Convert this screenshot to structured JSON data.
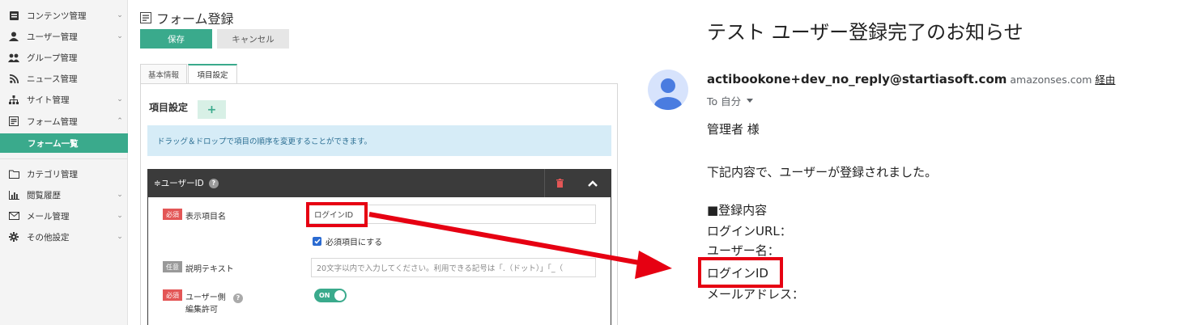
{
  "sidebar": {
    "items": [
      {
        "label": "コンテンツ管理",
        "icon": "content-icon",
        "chevron": "⌄"
      },
      {
        "label": "ユーザー管理",
        "icon": "user-icon",
        "chevron": "⌄"
      },
      {
        "label": "グループ管理",
        "icon": "group-icon",
        "chevron": ""
      },
      {
        "label": "ニュース管理",
        "icon": "rss-icon",
        "chevron": ""
      },
      {
        "label": "サイト管理",
        "icon": "sitemap-icon",
        "chevron": "⌄"
      },
      {
        "label": "フォーム管理",
        "icon": "form-icon",
        "chevron": "⌃"
      },
      {
        "label": "カテゴリ管理",
        "icon": "folder-icon",
        "chevron": ""
      },
      {
        "label": "閲覧履歴",
        "icon": "bar-chart-icon",
        "chevron": "⌄"
      },
      {
        "label": "メール管理",
        "icon": "mail-icon",
        "chevron": "⌄"
      },
      {
        "label": "その他設定",
        "icon": "gear-icon",
        "chevron": "⌄"
      }
    ],
    "active_subitem": "フォーム一覧"
  },
  "form": {
    "title": "フォーム登録",
    "save_label": "保存",
    "cancel_label": "キャンセル",
    "tabs": [
      "基本情報",
      "項目設定"
    ],
    "section_title": "項目設定",
    "add_label": "+",
    "info_text": "ドラッグ＆ドロップで項目の順序を変更することができます。",
    "item_header": "≑ユーザーID",
    "required_badge": "必須",
    "optional_badge": "任意",
    "field_name_label": "表示項目名",
    "field_name_value": "ログインID",
    "required_check_label": "必須項目にする",
    "desc_label": "説明テキスト",
    "desc_placeholder": "20文字以内で入力してください。利用できる記号は「.（ドット）」「_（",
    "edit_label_1": "ユーザー側",
    "edit_label_2": "編集許可",
    "toggle_label": "ON"
  },
  "email": {
    "subject": "テスト ユーザー登録完了のお知らせ",
    "from": "actibookone+dev_no_reply@startiasoft.com",
    "via_domain": "amazonses.com",
    "via_label": "経由",
    "to": "To 自分",
    "greeting": "管理者 様",
    "body_line": "下記内容で、ユーザーが登録されました。",
    "section": "■登録内容",
    "login_url": "ログインURL：",
    "user_name": "ユーザー名：",
    "login_id": "ログインID",
    "mail_address": "メールアドレス："
  },
  "colors": {
    "accent": "#3aaa8c",
    "highlight": "#e60012",
    "header_dark": "#3b3b3b",
    "info_bg": "#d6ecf7",
    "required": "#e35656"
  }
}
